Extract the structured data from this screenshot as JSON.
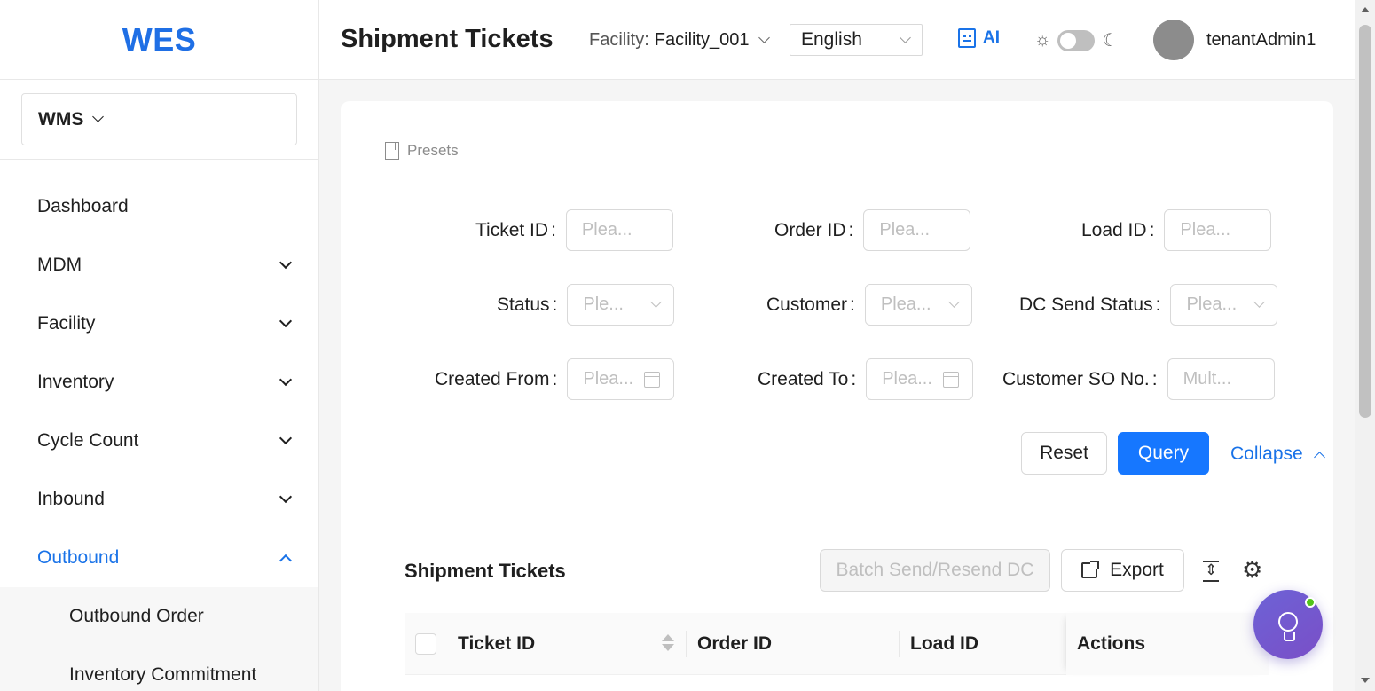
{
  "app": {
    "logo": "WES"
  },
  "sidebar": {
    "module": "WMS",
    "items": [
      {
        "label": "Dashboard",
        "expandable": false
      },
      {
        "label": "MDM",
        "expandable": true
      },
      {
        "label": "Facility",
        "expandable": true
      },
      {
        "label": "Inventory",
        "expandable": true
      },
      {
        "label": "Cycle Count",
        "expandable": true
      },
      {
        "label": "Inbound",
        "expandable": true
      },
      {
        "label": "Outbound",
        "expandable": true,
        "active": true
      }
    ],
    "subitems": [
      "Outbound Order",
      "Inventory Commitment"
    ]
  },
  "header": {
    "title": "Shipment Tickets",
    "facility_label": "Facility:",
    "facility_value": "Facility_001",
    "language": "English",
    "ai_label": "AI",
    "username": "tenantAdmin1"
  },
  "filters": {
    "presets_label": "Presets",
    "ticket_id": {
      "label": "Ticket ID",
      "placeholder": "Plea..."
    },
    "order_id": {
      "label": "Order ID",
      "placeholder": "Plea..."
    },
    "load_id": {
      "label": "Load ID",
      "placeholder": "Plea..."
    },
    "status": {
      "label": "Status",
      "placeholder": "Ple..."
    },
    "customer": {
      "label": "Customer",
      "placeholder": "Plea..."
    },
    "dc_send_status": {
      "label": "DC Send Status",
      "placeholder": "Plea..."
    },
    "created_from": {
      "label": "Created From",
      "placeholder": "Plea..."
    },
    "created_to": {
      "label": "Created To",
      "placeholder": "Plea..."
    },
    "customer_so": {
      "label": "Customer SO No.",
      "placeholder": "Mult..."
    },
    "reset_label": "Reset",
    "query_label": "Query",
    "collapse_label": "Collapse"
  },
  "table": {
    "title": "Shipment Tickets",
    "batch_label": "Batch Send/Resend DC",
    "export_label": "Export",
    "columns": [
      "Ticket ID",
      "Order ID",
      "Load ID",
      "Actions"
    ]
  },
  "colors": {
    "primary": "#1677ff",
    "logo": "#1f6fe5",
    "active_menu": "#1a73e8",
    "fab": "#6d62d6"
  }
}
